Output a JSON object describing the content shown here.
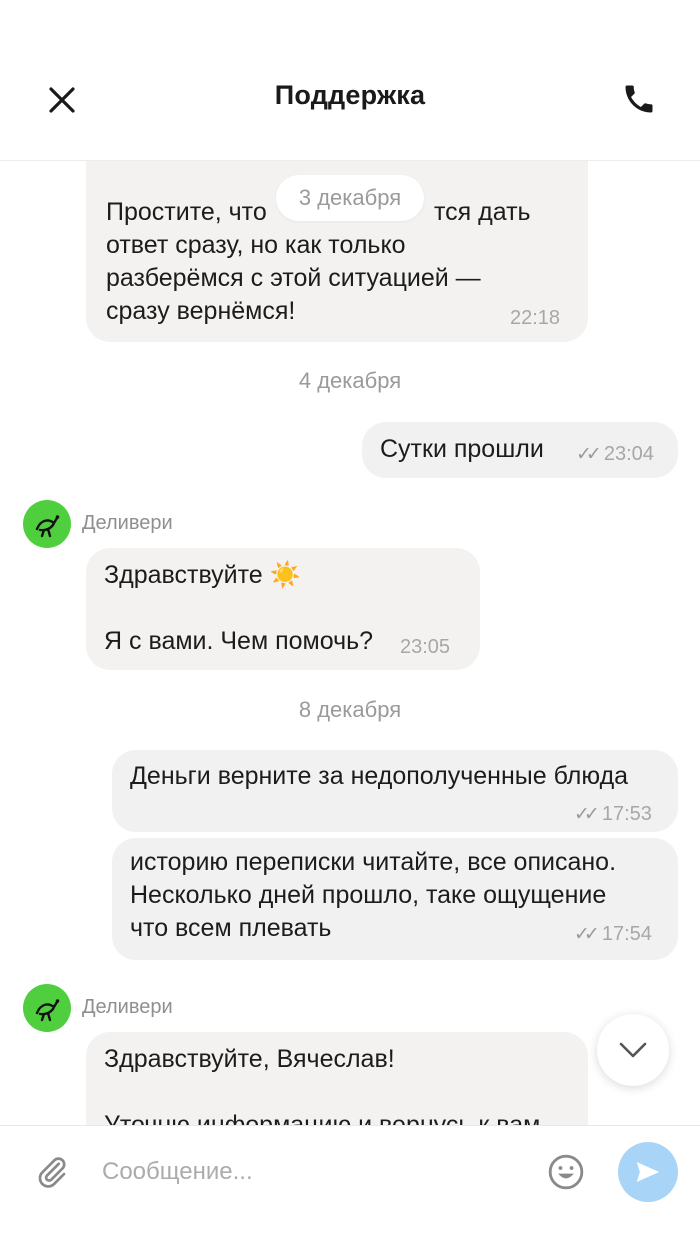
{
  "header": {
    "title": "Поддержка",
    "close_icon": "close-icon",
    "call_icon": "phone-icon"
  },
  "chat": {
    "floating_date": "3 декабря",
    "m1": {
      "text": "Простите, что ... ся дать ответ сразу, но как только разберёмся с этой ситуацией — сразу вернёмся!",
      "line1a": "Простите, что",
      "line1b": "тся дать",
      "line2": "ответ сразу, но как только",
      "line3": "разберёмся с этой ситуацией —",
      "line4": "сразу вернёмся!",
      "time": "22:18"
    },
    "date2": "4 декабря",
    "m2": {
      "text": "Сутки прошли",
      "ticks": "✓✓",
      "time": "23:04"
    },
    "sender1": {
      "name": "Деливери"
    },
    "m3": {
      "line1": "Здравствуйте ☀️",
      "line2": "Я с вами. Чем помочь?",
      "time": "23:05"
    },
    "date3": "8 декабря",
    "m4": {
      "text": "Деньги верните за недополученные блюда",
      "ticks": "✓✓",
      "time": "17:53"
    },
    "m5": {
      "line1": "историю переписки читайте, все описано.",
      "line2": "Несколько дней прошло, таке ощущение",
      "line3": "что всем плевать",
      "ticks": "✓✓",
      "time": "17:54"
    },
    "sender2": {
      "name": "Деливери"
    },
    "m6": {
      "line1": "Здравствуйте, Вячеслав!",
      "line2": "Уточню информацию и вернусь к вам"
    }
  },
  "composer": {
    "placeholder": "Сообщение..."
  },
  "colors": {
    "avatar": "#4fcf3d",
    "send": "#a8d4f7",
    "bubble": "#f3f2f1"
  }
}
